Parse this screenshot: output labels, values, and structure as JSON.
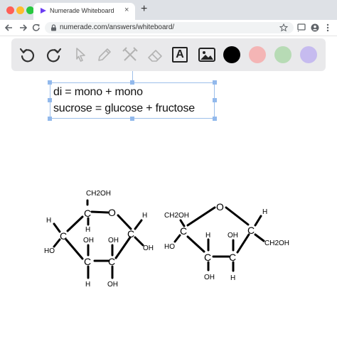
{
  "browser": {
    "tab_title": "Numerade Whiteboard",
    "tab_close": "×",
    "new_tab": "+",
    "url": "numerade.com/answers/whiteboard/",
    "traffic_colors": [
      "#ff5f57",
      "#febc2e",
      "#28c840"
    ]
  },
  "toolbar": {
    "tools": [
      "undo-icon",
      "redo-icon",
      "select-pointer-icon",
      "pen-icon",
      "tools-icon",
      "eraser-icon",
      "text-tool-icon",
      "image-icon"
    ],
    "text_tool_glyph": "A",
    "colors": [
      "#000000",
      "#f4b5b5",
      "#b7dbb5",
      "#c6bbef"
    ]
  },
  "textbox": {
    "line1": "di = mono + mono",
    "line2": "sucrose = glucose + fructose"
  },
  "glucose": {
    "top_sub": "CH2OH",
    "ring_o": "O",
    "c5": "C",
    "c5_h": "H",
    "c1": "C",
    "c1_h": "H",
    "c1_oh": "OH",
    "c4": "C",
    "c4_h": "H",
    "c4_ho": "HO",
    "c3": "C",
    "c3_oh": "OH",
    "c3_h": "H",
    "c2": "C",
    "c2_oh": "OH",
    "c2_oh_bottom": "OH"
  },
  "fructose": {
    "left_sub": "CH2OH",
    "ring_o": "O",
    "c2": "C",
    "c2_ho": "HO",
    "c5": "C",
    "c5_h": "H",
    "c5_sub": "CH2OH",
    "c3": "C",
    "c3_h": "H",
    "c3_oh": "OH",
    "c4": "C",
    "c4_oh": "OH",
    "c4_h": "H"
  }
}
